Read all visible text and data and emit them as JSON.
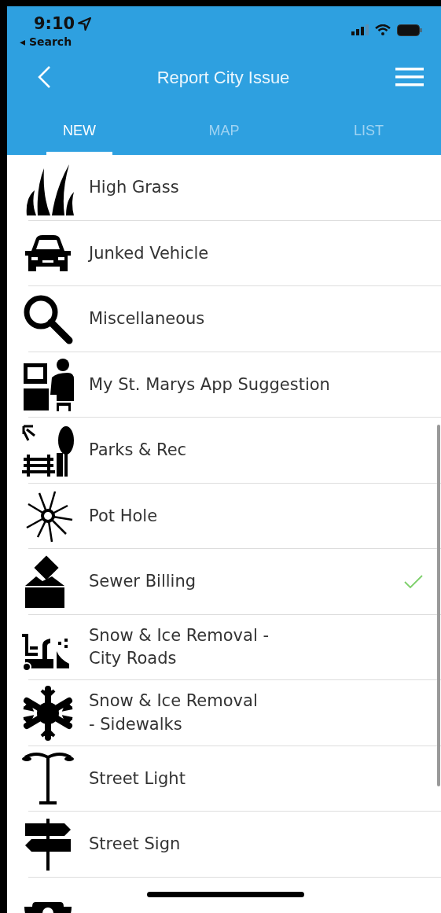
{
  "status_bar": {
    "time": "9:10",
    "back_label": "◂ Search"
  },
  "nav": {
    "title": "Report City Issue"
  },
  "tabs": [
    {
      "label": "NEW",
      "selected": true
    },
    {
      "label": "MAP",
      "selected": false
    },
    {
      "label": "LIST",
      "selected": false
    }
  ],
  "items": [
    {
      "label": "High Grass",
      "selected": false
    },
    {
      "label": "Junked Vehicle",
      "selected": false
    },
    {
      "label": "Miscellaneous",
      "selected": false
    },
    {
      "label": "My St. Marys App Suggestion",
      "selected": false
    },
    {
      "label": "Parks & Rec",
      "selected": false
    },
    {
      "label": "Pot Hole",
      "selected": false
    },
    {
      "label": "Sewer Billing",
      "selected": true
    },
    {
      "label": "Snow & Ice Removal -\nCity Roads",
      "selected": false
    },
    {
      "label": "Snow & Ice Removal\n- Sidewalks",
      "selected": false
    },
    {
      "label": "Street Light",
      "selected": false
    },
    {
      "label": "Street Sign",
      "selected": false
    }
  ]
}
